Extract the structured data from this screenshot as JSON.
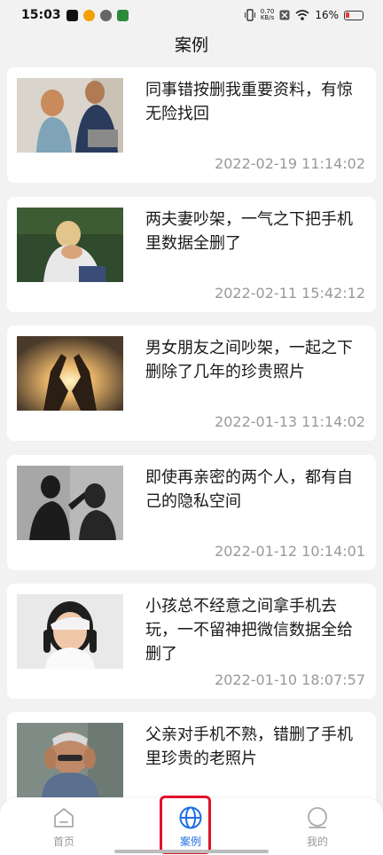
{
  "status": {
    "time": "15:03",
    "net_speed_value": "0.70",
    "net_speed_unit": "KB/s",
    "battery": "16%"
  },
  "header": {
    "title": "案例"
  },
  "cases": [
    {
      "title": "同事错按删我重要资料，有惊无险找回",
      "time": "2022-02-19 11:14:02"
    },
    {
      "title": "两夫妻吵架，一气之下把手机里数据全删了",
      "time": "2022-02-11 15:42:12"
    },
    {
      "title": "男女朋友之间吵架，一起之下删除了几年的珍贵照片",
      "time": "2022-01-13 11:14:02"
    },
    {
      "title": "即使再亲密的两个人，都有自己的隐私空间",
      "time": "2022-01-12 10:14:01"
    },
    {
      "title": "小孩总不经意之间拿手机去玩，一不留神把微信数据全给删了",
      "time": "2022-01-10 18:07:57"
    },
    {
      "title": "父亲对手机不熟，错删了手机里珍贵的老照片",
      "time": ""
    }
  ],
  "nav": {
    "home": "首页",
    "cases": "案例",
    "mine": "我的"
  },
  "colors": {
    "accent": "#1e6fe0",
    "highlight": "#e4102b"
  }
}
